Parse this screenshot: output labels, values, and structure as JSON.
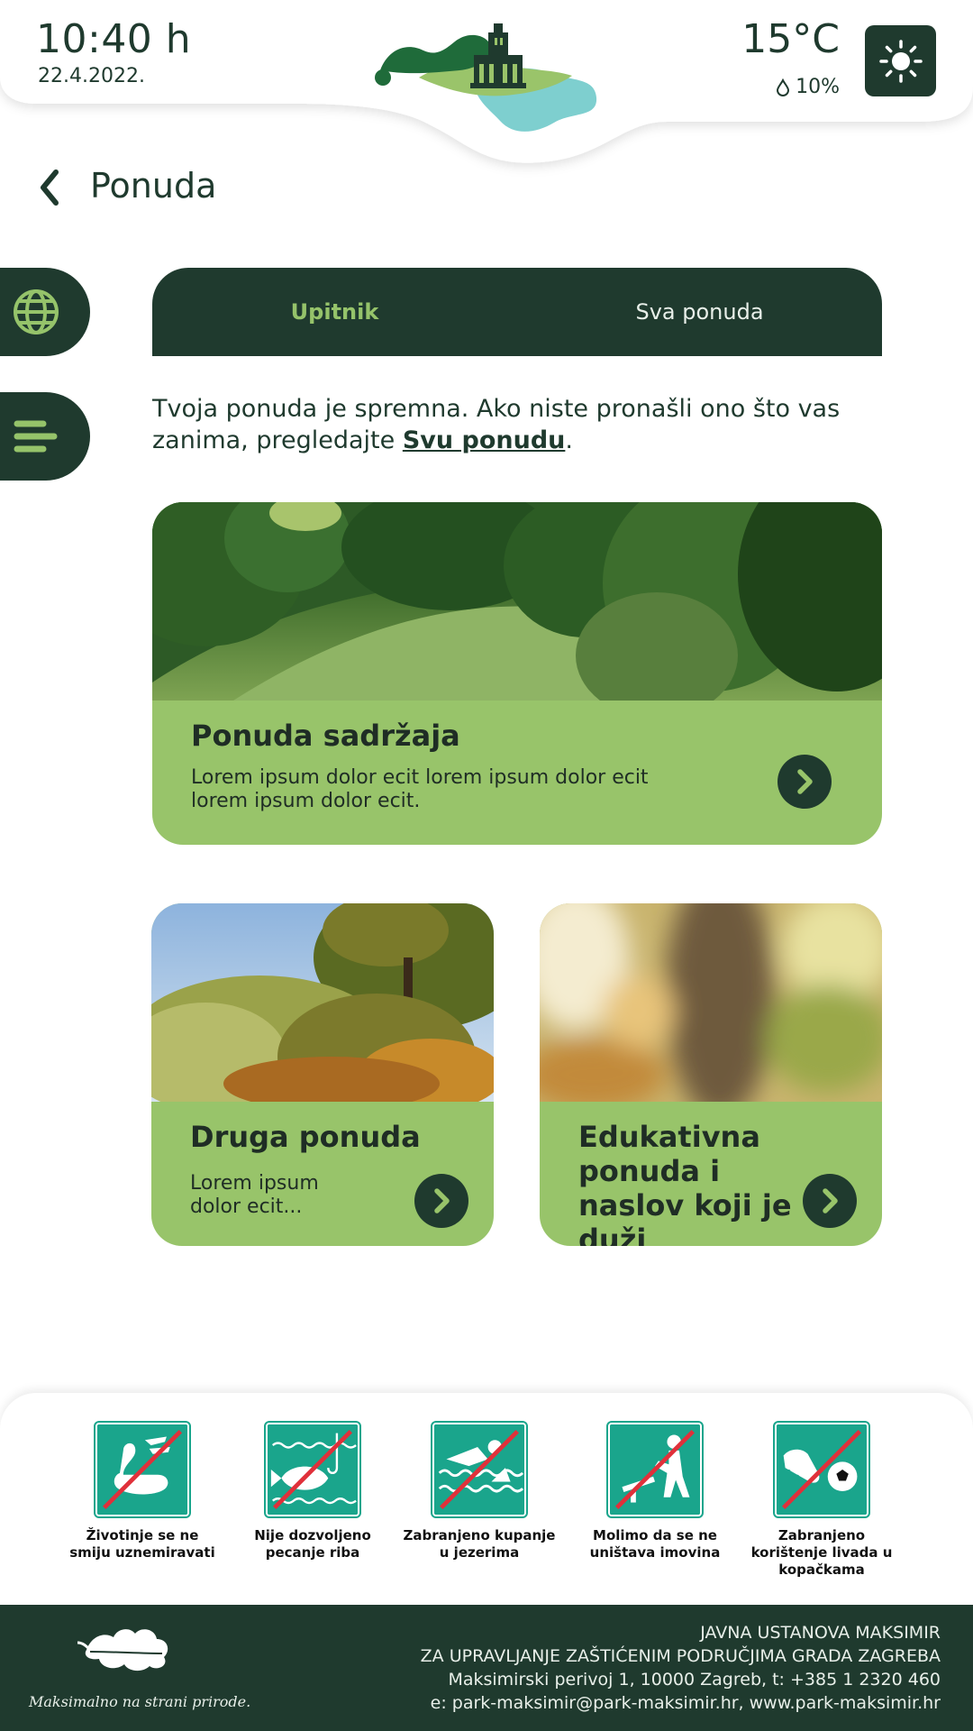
{
  "header": {
    "time": "10:40 h",
    "date": "22.4.2022.",
    "temperature": "15°C",
    "humidity": "10%",
    "weather_icon": "sun-icon"
  },
  "page": {
    "title": "Ponuda",
    "back_icon": "chevron-left-icon"
  },
  "side": {
    "language_icon": "globe-icon",
    "menu_icon": "menu-icon"
  },
  "tabs": [
    {
      "label": "Upitnik",
      "active": true
    },
    {
      "label": "Sva ponuda",
      "active": false
    }
  ],
  "intro": {
    "text": "Tvoja ponuda je spremna. Ako niste pronašli ono što vas zanima, pregledajte ",
    "link": "Svu ponudu",
    "end": "."
  },
  "cards": [
    {
      "title": "Ponuda sadržaja",
      "description": "Lorem ipsum dolor ecit lorem ipsum dolor ecit lorem ipsum dolor ecit."
    },
    {
      "title": "Druga ponuda",
      "description": "Lorem ipsum dolor ecit..."
    },
    {
      "title": "Edukativna ponuda i naslov koji je duži",
      "description": ""
    }
  ],
  "rules": [
    {
      "label": "Životinje se ne smiju uznemiravati",
      "icon": "no-swan-icon"
    },
    {
      "label": "Nije dozvoljeno pecanje riba",
      "icon": "no-fishing-icon"
    },
    {
      "label": "Zabranjeno kupanje u jezerima",
      "icon": "no-swimming-icon"
    },
    {
      "label": "Molimo da se ne uništava imovina",
      "icon": "no-vandalism-icon"
    },
    {
      "label": "Zabranjeno korištenje livada u kopačkama",
      "icon": "no-football-boots-icon"
    }
  ],
  "footer": {
    "tagline": "Maksimalno na strani prirode.",
    "org_line1": "JAVNA USTANOVA MAKSIMIR",
    "org_line2": "ZA UPRAVLJANJE ZAŠTIĆENIM PODRUČJIMA GRADA ZAGREBA",
    "address": "Maksimirski perivoj 1, 10000 Zagreb, t: +385 1 2320 460",
    "contact": "e: park-maksimir@park-maksimir.hr, www.park-maksimir.hr"
  },
  "colors": {
    "dark_green": "#1f3a2e",
    "light_green": "#98c46a",
    "teal": "#1aa58c",
    "prohibition_red": "#e0303a"
  }
}
